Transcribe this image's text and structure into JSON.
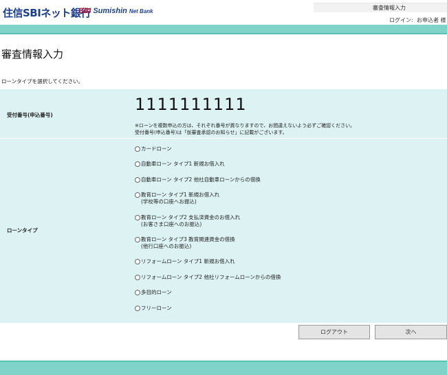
{
  "header": {
    "logo_jp": "住信SBIネット銀行",
    "logo_en_sbi": "SBI",
    "logo_en_name": "Sumishin",
    "logo_en_suffix": "Net Bank",
    "screen_name": "審査情報入力",
    "login_label": "ログイン:",
    "login_user": "お申込者 様"
  },
  "page": {
    "title": "審査情報入力",
    "instruction": "ローンタイプを選択してください。"
  },
  "application": {
    "label": "受付番号(申込番号)",
    "number": "1111111111",
    "note_line1": "※ローンを複数申込の方は、それぞれ番号が異なりますので、お間違えないよう必ずご確認ください。",
    "note_line2": "受付番号(申込番号)は「仮審査承認のお知らせ」に記載がございます。"
  },
  "loan": {
    "label": "ローンタイプ",
    "options": [
      {
        "text": "カードローン",
        "sub": ""
      },
      {
        "text": "自動車ローン タイプ1 新規お借入れ",
        "sub": ""
      },
      {
        "text": "自動車ローン タイプ2 他社自動車ローンからの借換",
        "sub": ""
      },
      {
        "text": "教育ローン タイプ1 新規お借入れ",
        "sub": "(学校等の口座へお振込)"
      },
      {
        "text": "教育ローン タイプ2 支払済資金のお借入れ",
        "sub": "(お客さま口座へのお振込)"
      },
      {
        "text": "教育ローン タイプ3 教育関連資金の借換",
        "sub": "(他行口座へのお振込)"
      },
      {
        "text": "リフォームローン タイプ1 新規お借入れ",
        "sub": ""
      },
      {
        "text": "リフォームローン タイプ2 他社リフォームローンからの借換",
        "sub": ""
      },
      {
        "text": "多目的ローン",
        "sub": ""
      },
      {
        "text": "フリーローン",
        "sub": ""
      }
    ]
  },
  "buttons": {
    "logout": "ログアウト",
    "next": "次へ"
  },
  "colors": {
    "accent_bar": "#7fd3c9",
    "form_bg": "#dcf2f3",
    "brand": "#1b3e8c"
  }
}
